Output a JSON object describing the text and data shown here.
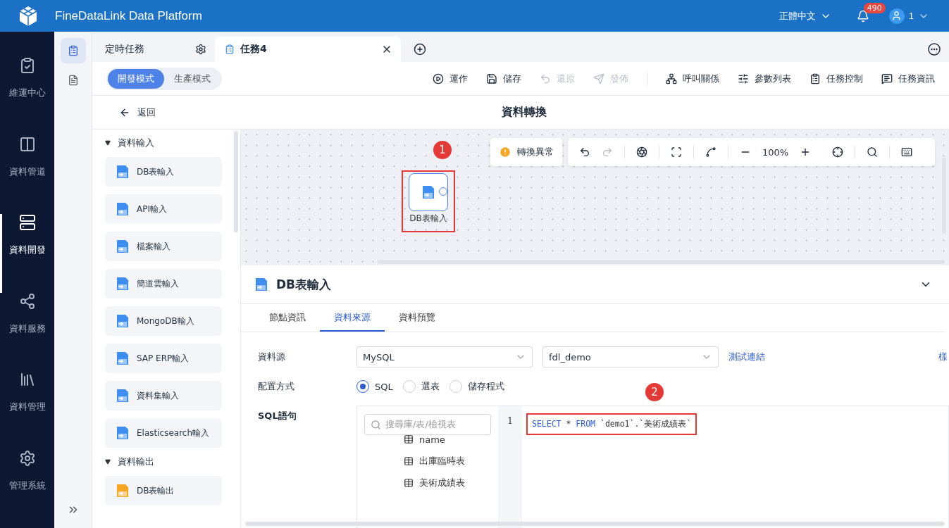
{
  "header": {
    "title": "FineDataLink Data Platform",
    "language": "正體中文",
    "notifications": "490",
    "user": "1"
  },
  "nav": [
    {
      "label": "維運中心",
      "selected": false
    },
    {
      "label": "資料管道",
      "selected": false
    },
    {
      "label": "資料開發",
      "selected": true
    },
    {
      "label": "資料服務",
      "selected": false
    },
    {
      "label": "資料管理",
      "selected": false
    },
    {
      "label": "管理系統",
      "selected": false
    }
  ],
  "subnav": [
    {
      "selected": true
    },
    {
      "selected": false
    }
  ],
  "tabs": [
    {
      "label": "定時任務",
      "kind": "settings",
      "selected": false
    },
    {
      "label": "任務4",
      "kind": "closable",
      "selected": true
    }
  ],
  "modes": [
    {
      "label": "開發模式",
      "selected": true
    },
    {
      "label": "生產模式",
      "selected": false
    }
  ],
  "toolbar": [
    {
      "label": "運作",
      "disabled": false
    },
    {
      "label": "儲存",
      "disabled": false
    },
    {
      "label": "還原",
      "disabled": true
    },
    {
      "label": "發佈",
      "disabled": true
    },
    {
      "label": "呼叫關係",
      "disabled": false
    },
    {
      "label": "參數列表",
      "disabled": false
    },
    {
      "label": "任務控制",
      "disabled": false
    },
    {
      "label": "任務資訊",
      "disabled": false
    }
  ],
  "back": "返回",
  "page_title": "資料轉換",
  "palette": [
    {
      "title": "資料輸入",
      "expanded": true,
      "items": [
        {
          "label": "DB表輸入",
          "kind": "input"
        },
        {
          "label": "API輸入",
          "kind": "input"
        },
        {
          "label": "檔案輸入",
          "kind": "input"
        },
        {
          "label": "簡道雲輸入",
          "kind": "input"
        },
        {
          "label": "MongoDB輸入",
          "kind": "input"
        },
        {
          "label": "SAP ERP輸入",
          "kind": "input"
        },
        {
          "label": "資料集輸入",
          "kind": "input"
        },
        {
          "label": "Elasticsearch輸入",
          "kind": "input"
        }
      ]
    },
    {
      "title": "資料輸出",
      "expanded": true,
      "items": [
        {
          "label": "DB表輸出",
          "kind": "output"
        }
      ]
    }
  ],
  "canvas": {
    "warning": "轉換異常",
    "zoom": "100%",
    "node": {
      "label": "DB表輸入",
      "marker": "1"
    }
  },
  "panel": {
    "title": "DB表輸入",
    "tabs": [
      {
        "label": "節點資訊",
        "selected": false
      },
      {
        "label": "資料來源",
        "selected": true
      },
      {
        "label": "資料預覽",
        "selected": false
      }
    ],
    "source_label": "資料源",
    "source": "MySQL",
    "database": "fdl_demo",
    "test_link": "測試連結",
    "cut_link": "樣",
    "config_label": "配置方式",
    "config_options": [
      {
        "label": "SQL",
        "selected": true
      },
      {
        "label": "選表",
        "selected": false
      },
      {
        "label": "儲存程式",
        "selected": false
      }
    ],
    "sql_label": "SQL語句",
    "search_placeholder": "搜尋庫/表/檢視表",
    "tables": [
      "name",
      "出庫臨時表",
      "美術成績表"
    ],
    "line_number": "1",
    "code": [
      {
        "text": "SELECT",
        "kind": "keyword"
      },
      {
        "text": " * ",
        "kind": "plain"
      },
      {
        "text": "FROM",
        "kind": "keyword"
      },
      {
        "text": " `demo1`.`美術成績表`",
        "kind": "plain"
      }
    ],
    "marker": "2"
  }
}
